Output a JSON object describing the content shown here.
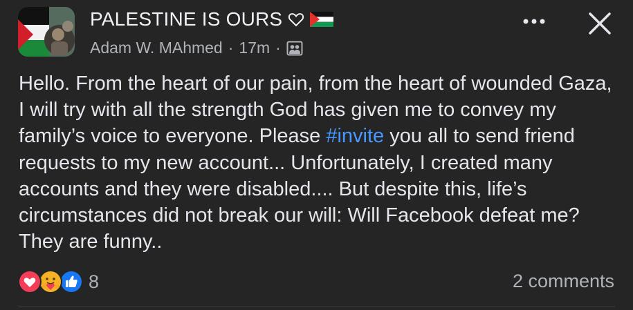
{
  "header": {
    "group_name": "PALESTINE IS OURS",
    "author": "Adam W. MAhmed",
    "separator": "·",
    "time": "17m",
    "separator2": "·"
  },
  "post": {
    "text_before": "Hello. From the heart of our pain, from the heart of wounded Gaza, I will try with all the strength God has given me to convey my family’s voice to everyone. Please ",
    "hashtag": "#invite",
    "text_after": " you all to send friend requests to my new account... Unfortunately, I created many accounts and they were disabled.... But despite this, life’s circumstances did not break our will: Will Facebook defeat me? They are funny.."
  },
  "footer": {
    "reaction_count": "8",
    "comments_label": "2 comments"
  },
  "icons": {
    "heart": "heart-outline-icon",
    "flag": "palestine-flag-icon",
    "privacy": "group-privacy-icon",
    "more": "more-dots-icon",
    "close": "close-icon",
    "love": "love-reaction-icon",
    "care": "care-reaction-icon",
    "like": "like-reaction-icon"
  },
  "colors": {
    "background": "#252526",
    "text": "#e4e6eb",
    "secondary": "#b0b3b8",
    "hashtag": "#4599ff",
    "like_blue": "#1877f2",
    "love_red": "#f33e58",
    "care_yellow": "#f7b125"
  }
}
